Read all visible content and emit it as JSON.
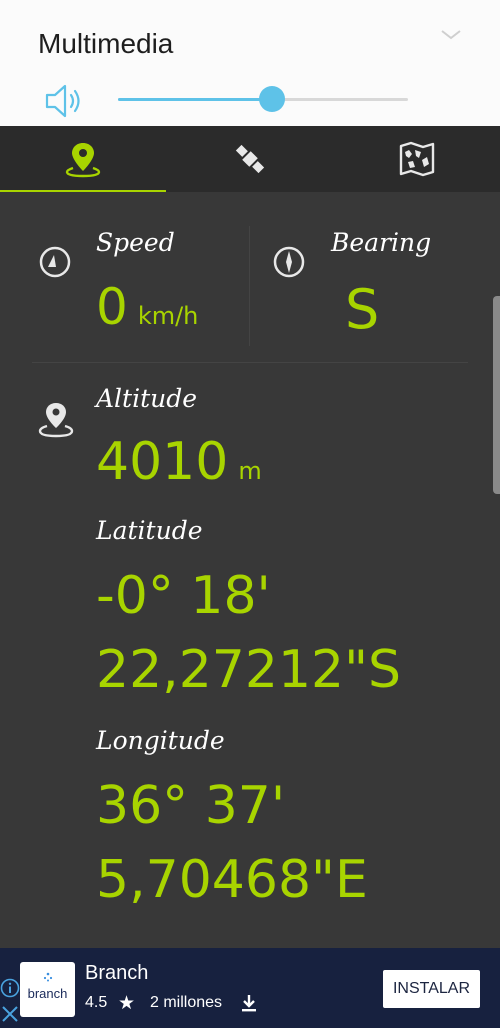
{
  "volume_panel": {
    "title": "Multimedia",
    "level_percent": 53,
    "accent": "#5ec2e8",
    "icons": [
      "speaker-icon",
      "chevron-down-icon"
    ]
  },
  "tabs": [
    {
      "id": "location",
      "icon": "location-pin-icon",
      "active": true
    },
    {
      "id": "satellites",
      "icon": "satellite-icon",
      "active": false
    },
    {
      "id": "map",
      "icon": "map-icon",
      "active": false
    }
  ],
  "speed": {
    "label": "Speed",
    "value": "0",
    "unit": "km/h"
  },
  "bearing": {
    "label": "Bearing",
    "value": "S"
  },
  "altitude": {
    "label": "Altitude",
    "value": "4010",
    "unit": "m"
  },
  "latitude": {
    "label": "Latitude",
    "line1": "-0° 18'",
    "line2": "22,27212\"S"
  },
  "longitude": {
    "label": "Longitude",
    "line1": "36° 37'",
    "line2": "5,70468\"E"
  },
  "ad": {
    "logo_text": "branch",
    "title": "Branch",
    "rating": "4.5",
    "downloads": "2 millones",
    "button": "INSTALAR"
  },
  "colors": {
    "value_green": "#a8d400",
    "background": "#383838",
    "tab_bar": "#2b2b2b",
    "ad_background": "#17213f"
  }
}
